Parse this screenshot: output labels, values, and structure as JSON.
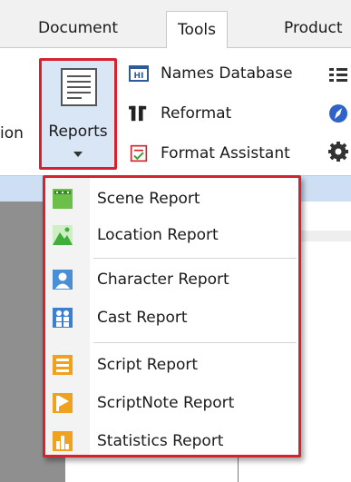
{
  "tabs": {
    "document": "Document",
    "tools": "Tools",
    "product": "Product"
  },
  "ribbon": {
    "cut_off_label": "ion",
    "reports_label": "Reports",
    "names_database": "Names Database",
    "reformat": "Reformat",
    "format_assistant": "Format Assistant",
    "names_database_icon_text": "HI"
  },
  "menu": {
    "items": [
      {
        "label": "Scene Report",
        "icon": "scene-icon",
        "color": "#6cc04a"
      },
      {
        "label": "Location Report",
        "icon": "landscape-icon",
        "color": "#3fae3a"
      },
      {
        "label": "Character Report",
        "icon": "person-icon",
        "color": "#4a8fd6"
      },
      {
        "label": "Cast Report",
        "icon": "people-icon",
        "color": "#3c7fd0"
      },
      {
        "label": "Script Report",
        "icon": "script-icon",
        "color": "#f0a21e"
      },
      {
        "label": "ScriptNote Report",
        "icon": "flag-icon",
        "color": "#f0a21e"
      },
      {
        "label": "Statistics Report",
        "icon": "bar-chart-icon",
        "color": "#f0a21e"
      }
    ]
  },
  "colors": {
    "highlight_border": "#d4232e",
    "ribbon_band": "#cfdff3",
    "selected_bg": "#d8e6f6"
  }
}
